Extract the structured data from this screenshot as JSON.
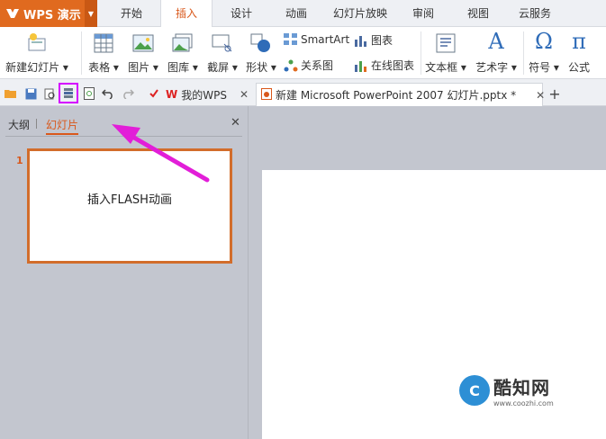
{
  "app": {
    "title": "WPS 演示"
  },
  "menu_tabs": [
    "开始",
    "插入",
    "设计",
    "动画",
    "幻灯片放映",
    "审阅",
    "视图",
    "云服务"
  ],
  "active_menu_tab": "插入",
  "ribbon": {
    "new_slide": "新建幻灯片",
    "table": "表格",
    "picture": "图片",
    "gallery": "图库",
    "screenshot": "截屏",
    "shape": "形状",
    "smartart": "SmartArt",
    "chart": "图表",
    "relation": "关系图",
    "online_chart": "在线图表",
    "textbox": "文本框",
    "wordart": "艺术字",
    "symbol": "符号",
    "formula": "公式",
    "symbol_glyph": "Ω",
    "formula_glyph": "π",
    "wordart_glyph": "A"
  },
  "doc_tabs": [
    {
      "label": "我的WPS"
    },
    {
      "label": "新建 Microsoft PowerPoint 2007 幻灯片.pptx *"
    }
  ],
  "left_panel": {
    "tab_outline": "大纲",
    "tab_slides": "幻灯片",
    "slide_number": "1",
    "slide_text": "插入FLASH动画"
  },
  "watermark": {
    "brand": "酷知网",
    "url": "www.coozhi.com",
    "logo_letter": "C"
  },
  "colors": {
    "accent": "#d9581b",
    "app_orange": "#e06a1f",
    "highlight": "#d400ff",
    "arrow": "#e21ed8"
  }
}
